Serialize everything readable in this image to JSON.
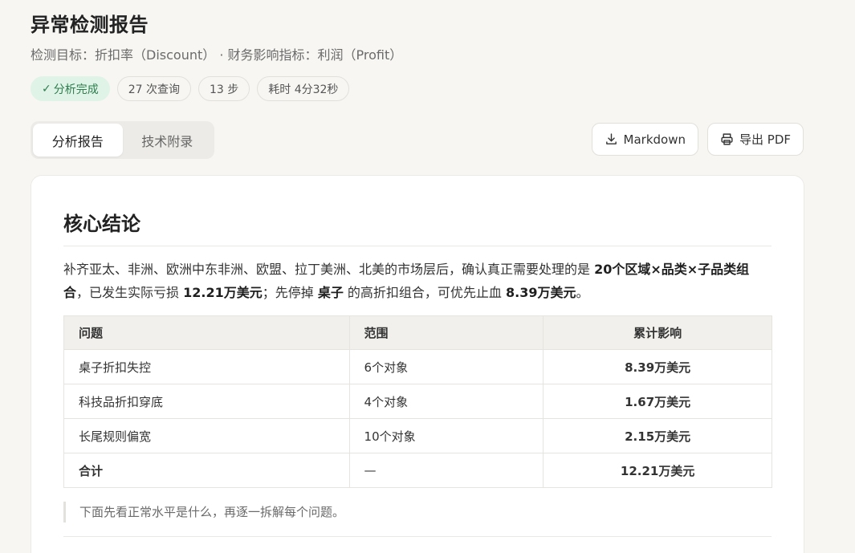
{
  "header": {
    "title": "异常检测报告",
    "subtitle": "检测目标：折扣率（Discount） · 财务影响指标：利润（Profit）"
  },
  "badges": {
    "status": "分析完成",
    "queries": "27 次查询",
    "steps": "13 步",
    "duration": "耗时 4分32秒"
  },
  "tabs": [
    {
      "label": "分析报告",
      "active": true
    },
    {
      "label": "技术附录",
      "active": false
    }
  ],
  "actions": {
    "markdown": "Markdown",
    "pdf": "导出 PDF"
  },
  "card": {
    "section_title": "核心结论",
    "summary": {
      "t1": "补齐亚太、非洲、欧洲中东非洲、欧盟、拉丁美洲、北美的市场层后，确认真正需要处理的是 ",
      "b1": "20个区域×品类×子品类组合",
      "t2": "，已发生实际亏损 ",
      "b2": "12.21万美元",
      "t3": "；先停掉 ",
      "b3": "桌子",
      "t4": " 的高折扣组合，可优先止血 ",
      "b4": "8.39万美元",
      "t5": "。"
    },
    "table": {
      "headers": [
        "问题",
        "范围",
        "累计影响"
      ],
      "rows": [
        [
          "桌子折扣失控",
          "6个对象",
          "8.39万美元"
        ],
        [
          "科技品折扣穿底",
          "4个对象",
          "1.67万美元"
        ],
        [
          "长尾规则偏宽",
          "10个对象",
          "2.15万美元"
        ]
      ],
      "total": [
        "合计",
        "—",
        "12.21万美元"
      ]
    },
    "note": "下面先看正常水平是什么，再逐一拆解每个问题。"
  }
}
